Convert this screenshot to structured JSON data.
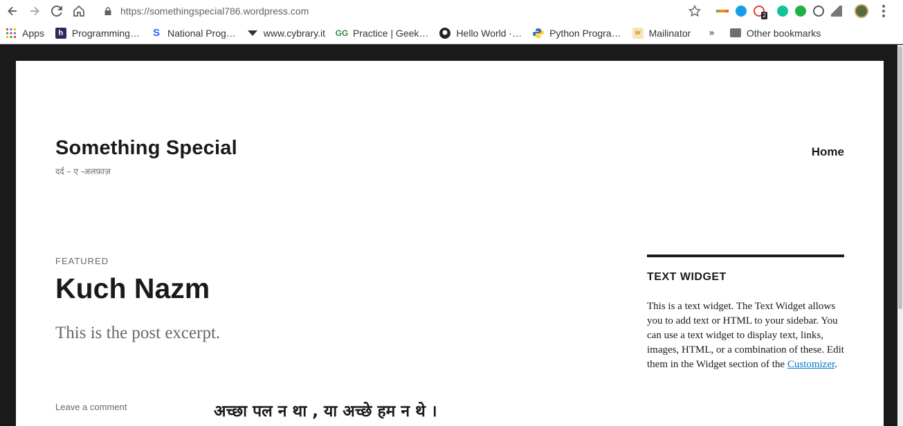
{
  "browser": {
    "url": "https://somethingspecial786.wordpress.com",
    "extension_badge": "2"
  },
  "bookmarks": [
    {
      "label": "Apps",
      "icon": "apps-grid-icon"
    },
    {
      "label": "Programming…",
      "icon": "h-icon"
    },
    {
      "label": "National Prog…",
      "icon": "s-icon"
    },
    {
      "label": "www.cybrary.it",
      "icon": "cybrary-icon"
    },
    {
      "label": "Practice | Geek…",
      "icon": "gfg-icon"
    },
    {
      "label": "Hello World ·…",
      "icon": "github-icon"
    },
    {
      "label": "Python Progra…",
      "icon": "python-icon"
    },
    {
      "label": "Mailinator",
      "icon": "mailinator-icon"
    }
  ],
  "bookmarks_more": "»",
  "other_bookmarks": "Other bookmarks",
  "site": {
    "title": "Something Special",
    "tagline": "दर्द – ए -अलफ़ाज़",
    "nav_home": "Home"
  },
  "post": {
    "featured": "FEATURED",
    "title": "Kuch Nazm",
    "excerpt": "This is the post excerpt.",
    "leave_comment": "Leave a comment",
    "first_line": "अच्छा पल न था , या अच्छे हम न थे ।"
  },
  "widget": {
    "title": "TEXT WIDGET",
    "text": "This is a text widget. The Text Widget allows you to add text or HTML to your sidebar. You can use a text widget to display text, links, images, HTML, or a combination of these. Edit them in the Widget section of the",
    "link": "Customizer",
    "after_link": "."
  },
  "colors": {
    "link": "#007acc",
    "text": "#1a1a1a",
    "muted": "#686868"
  }
}
